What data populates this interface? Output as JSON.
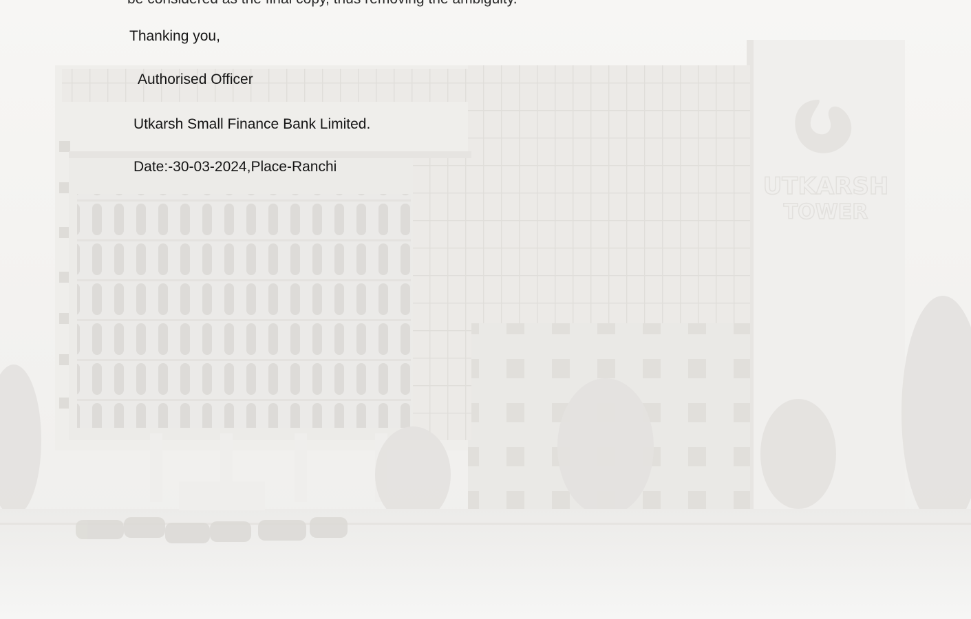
{
  "letter": {
    "cut_off_line": "be considered as the final copy, thus removing the ambiguity.",
    "closing": "Thanking you,",
    "signatory_title": "Authorised Officer",
    "bank_name": "Utkarsh Small Finance Bank Limited.",
    "date_place": "Date:-30-03-2024,Place-Ranchi"
  },
  "watermark": {
    "tower_text_line1": "UTKARSH",
    "tower_text_line2": "TOWER"
  }
}
